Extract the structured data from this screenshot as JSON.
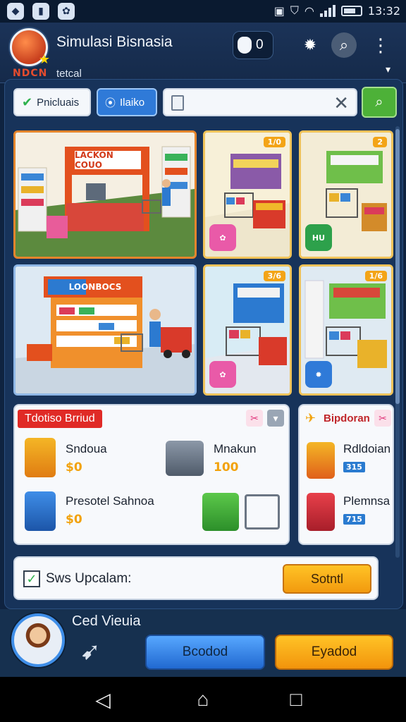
{
  "status_bar": {
    "time": "13:32"
  },
  "header": {
    "title": "Simulasi Bisnasia",
    "coins": "0",
    "subtitle_left": "NDCN",
    "subtitle_right": "tetcal"
  },
  "toolbar": {
    "btn1_label": "Pnicluais",
    "btn2_label": "Ilaiko",
    "search_placeholder": ""
  },
  "tiles": [
    {
      "sign": "LACKON COUO"
    },
    {
      "badge": "1/0"
    },
    {
      "badge": "2"
    },
    {
      "sign": "LOONBOCS"
    },
    {
      "badge": "3/6"
    },
    {
      "badge": "1/6"
    }
  ],
  "shop_card": {
    "title": "Tdotiso Brriud",
    "items": [
      {
        "name": "Sndoua",
        "price": "$0"
      },
      {
        "name": "Mnakun",
        "price": "100"
      },
      {
        "name": "Presotel Sahnoa",
        "price": "$0"
      }
    ]
  },
  "side_card": {
    "title": "Bipdoran",
    "items": [
      {
        "name": "Rdldoian",
        "price": "315"
      },
      {
        "name": "Plemnsa",
        "price": "715"
      }
    ]
  },
  "upgrade": {
    "label": "Sws Upcalam:",
    "button": "Sotntl"
  },
  "player": {
    "name": "Ced Vieuia"
  },
  "actions": {
    "blue": "Bcodod",
    "orange": "Eyadod"
  },
  "colors": {
    "accent_orange": "#f3a417",
    "accent_blue": "#2f7ad8",
    "accent_green": "#4db138",
    "panel_bg": "#17335a"
  }
}
